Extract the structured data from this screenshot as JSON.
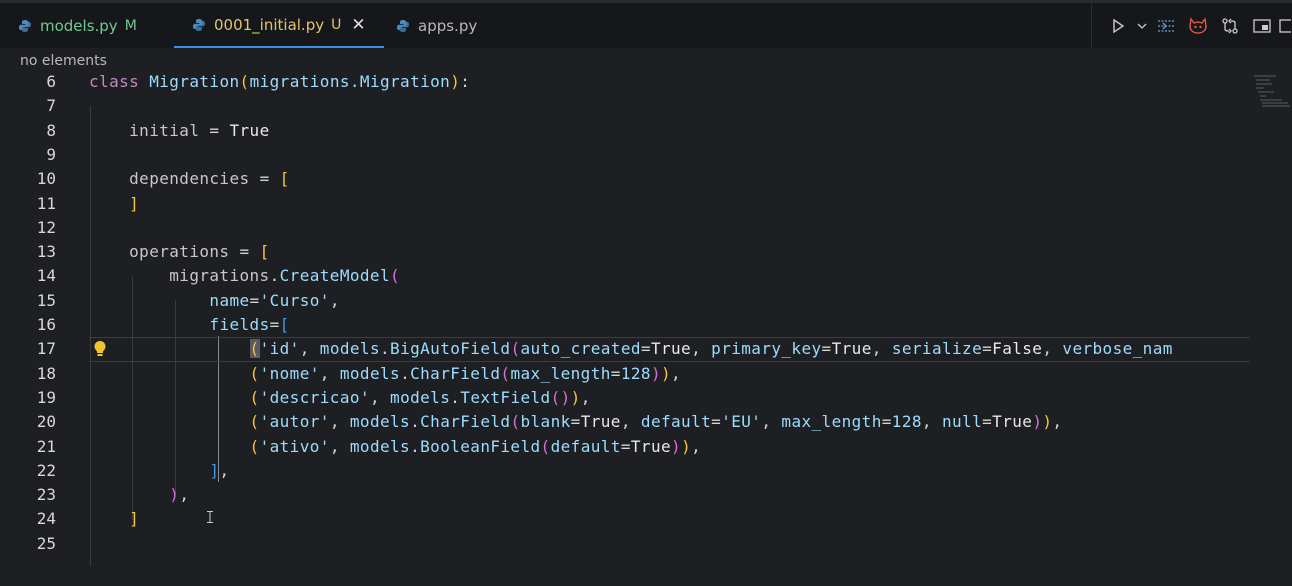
{
  "tabs": [
    {
      "label": "models.py",
      "status": "M",
      "active": false
    },
    {
      "label": "0001_initial.py",
      "status": "U",
      "active": true
    },
    {
      "label": "apps.py",
      "status": "",
      "active": false
    }
  ],
  "breadcrumb": "no elements",
  "colors": {
    "accent": "#3b8eea",
    "modified": "#73c991",
    "untracked": "#e3c46a"
  },
  "editor": {
    "lines": [
      {
        "n": "6"
      },
      {
        "n": "7"
      },
      {
        "n": "8"
      },
      {
        "n": "9"
      },
      {
        "n": "10"
      },
      {
        "n": "11"
      },
      {
        "n": "12"
      },
      {
        "n": "13"
      },
      {
        "n": "14"
      },
      {
        "n": "15"
      },
      {
        "n": "16"
      },
      {
        "n": "17"
      },
      {
        "n": "18"
      },
      {
        "n": "19"
      },
      {
        "n": "20"
      },
      {
        "n": "21"
      },
      {
        "n": "22"
      },
      {
        "n": "23"
      },
      {
        "n": "24"
      },
      {
        "n": "25"
      }
    ],
    "tokens": {
      "class_kw": "class",
      "class_name": "Migration",
      "base": "migrations.Migration",
      "initial": "initial",
      "true": "True",
      "false": "False",
      "dependencies": "dependencies",
      "operations": "operations",
      "migrations": "migrations",
      "create_model": "CreateModel",
      "name": "name",
      "curso": "'Curso'",
      "fields": "fields",
      "id": "'id'",
      "models": "models",
      "big_auto": "BigAutoField",
      "auto_created": "auto_created",
      "primary_key": "primary_key",
      "serialize": "serialize",
      "verbose_nam": "verbose_nam",
      "nome": "'nome'",
      "char_field": "CharField",
      "max_length": "max_length",
      "n128": "128",
      "descricao": "'descricao'",
      "text_field": "TextField",
      "autor": "'autor'",
      "blank": "blank",
      "default": "default",
      "eu": "'EU'",
      "null": "null",
      "ativo": "'ativo'",
      "boolean_field": "BooleanField"
    }
  },
  "toolbar": {
    "icons": [
      "run-icon",
      "chevron-down-icon",
      "sequence-icon",
      "copilot-icon",
      "compare-changes-icon",
      "layout-icon",
      "split-editor-icon"
    ]
  }
}
